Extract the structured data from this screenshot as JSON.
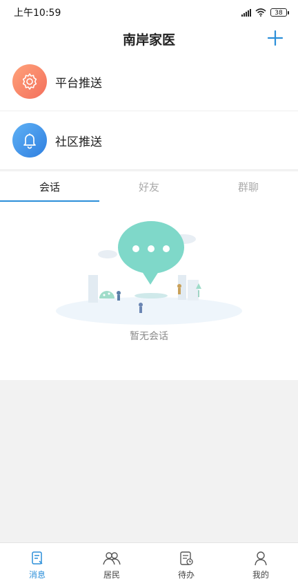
{
  "status": {
    "time": "上午10:59",
    "battery": "38"
  },
  "header": {
    "title": "南岸家医"
  },
  "push_items": [
    {
      "label": "平台推送",
      "icon": "gear-icon",
      "color": "#f47a5e"
    },
    {
      "label": "社区推送",
      "icon": "bell-icon",
      "color": "#3f8fe8"
    }
  ],
  "tabs": [
    {
      "label": "会话",
      "active": true
    },
    {
      "label": "好友",
      "active": false
    },
    {
      "label": "群聊",
      "active": false
    }
  ],
  "empty_state": {
    "text": "暂无会话"
  },
  "tabbar": [
    {
      "label": "消息",
      "icon": "message-icon",
      "active": true
    },
    {
      "label": "居民",
      "icon": "residents-icon",
      "active": false
    },
    {
      "label": "待办",
      "icon": "todo-icon",
      "active": false
    },
    {
      "label": "我的",
      "icon": "profile-icon",
      "active": false
    }
  ],
  "colors": {
    "accent": "#2a8ed9",
    "background": "#f2f2f2"
  }
}
